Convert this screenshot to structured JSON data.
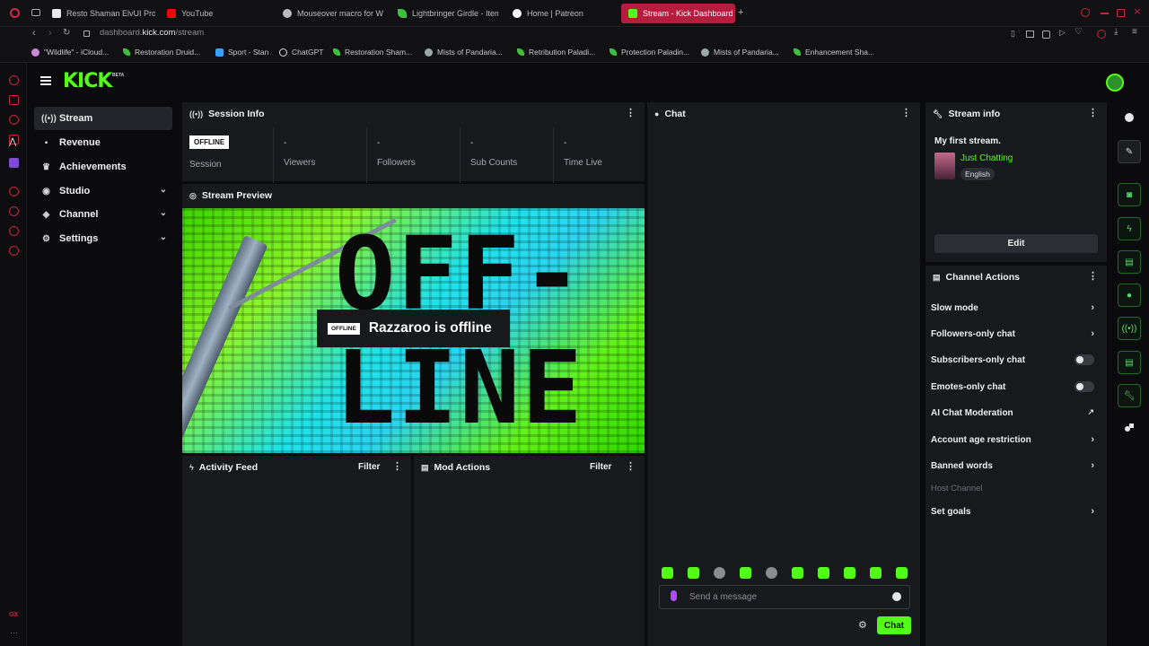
{
  "browser": {
    "tabs": [
      {
        "label": "Resto Shaman ElvUI Profi",
        "active": false
      },
      {
        "label": "YouTube",
        "active": false
      },
      {
        "label": "Mouseover macro for Wi",
        "active": false
      },
      {
        "label": "Lightbringer Girdle - Item",
        "active": false
      },
      {
        "label": "Home | Patreon",
        "active": false
      },
      {
        "label": "Stream - Kick Dashboard",
        "active": true
      }
    ],
    "url_host": "dashboard.",
    "url_domain": "kick.com",
    "url_path": "/stream",
    "bookmarks": [
      "\"Wildlife\" - iCloud...",
      "Restoration Druid...",
      "Sport - Stan",
      "ChatGPT",
      "Restoration Sham...",
      "Mists of Pandaria...",
      "Retribution Paladi...",
      "Protection Paladin...",
      "Mists of Pandaria...",
      "Enhancement Sha..."
    ]
  },
  "kick": {
    "logo": "KICK",
    "logo_badge": "BETA",
    "accent": "#53fc18"
  },
  "nav": {
    "items": [
      {
        "label": "Stream",
        "icon": "broadcast-icon",
        "active": true,
        "expandable": false
      },
      {
        "label": "Revenue",
        "icon": "revenue-icon",
        "active": false,
        "expandable": false
      },
      {
        "label": "Achievements",
        "icon": "trophy-icon",
        "active": false,
        "expandable": false
      },
      {
        "label": "Studio",
        "icon": "studio-icon",
        "active": false,
        "expandable": true
      },
      {
        "label": "Channel",
        "icon": "channel-icon",
        "active": false,
        "expandable": true
      },
      {
        "label": "Settings",
        "icon": "gear-icon",
        "active": false,
        "expandable": true
      }
    ]
  },
  "session": {
    "title": "Session Info",
    "status_badge": "OFFLINE",
    "session_label": "Session",
    "stats": [
      {
        "value": "-",
        "label": "Viewers"
      },
      {
        "value": "-",
        "label": "Followers"
      },
      {
        "value": "-",
        "label": "Sub Counts"
      },
      {
        "value": "-",
        "label": "Time Live"
      }
    ]
  },
  "preview": {
    "title": "Stream Preview",
    "overlay_badge": "OFFLINE",
    "overlay_text": "Razzaroo is offline",
    "art_line1": "OFF-",
    "art_line2": "LINE"
  },
  "activity": {
    "title": "Activity Feed",
    "filter": "Filter"
  },
  "mod": {
    "title": "Mod Actions",
    "filter": "Filter"
  },
  "chat": {
    "title": "Chat",
    "placeholder": "Send a message",
    "send_label": "Chat"
  },
  "stream_info": {
    "title": "Stream info",
    "stream_title": "My first stream.",
    "category": "Just Chatting",
    "language": "English",
    "edit_label": "Edit"
  },
  "channel_actions": {
    "title": "Channel Actions",
    "rows": [
      {
        "label": "Slow mode",
        "kind": "chevron"
      },
      {
        "label": "Followers-only chat",
        "kind": "chevron"
      },
      {
        "label": "Subscribers-only chat",
        "kind": "toggle",
        "on": false
      },
      {
        "label": "Emotes-only chat",
        "kind": "toggle",
        "on": false
      },
      {
        "label": "AI Chat Moderation",
        "kind": "external"
      },
      {
        "label": "Account age restriction",
        "kind": "chevron"
      },
      {
        "label": "Banned words",
        "kind": "chevron"
      },
      {
        "label": "Host Channel",
        "kind": "disabled"
      },
      {
        "label": "Set goals",
        "kind": "chevron"
      }
    ]
  }
}
